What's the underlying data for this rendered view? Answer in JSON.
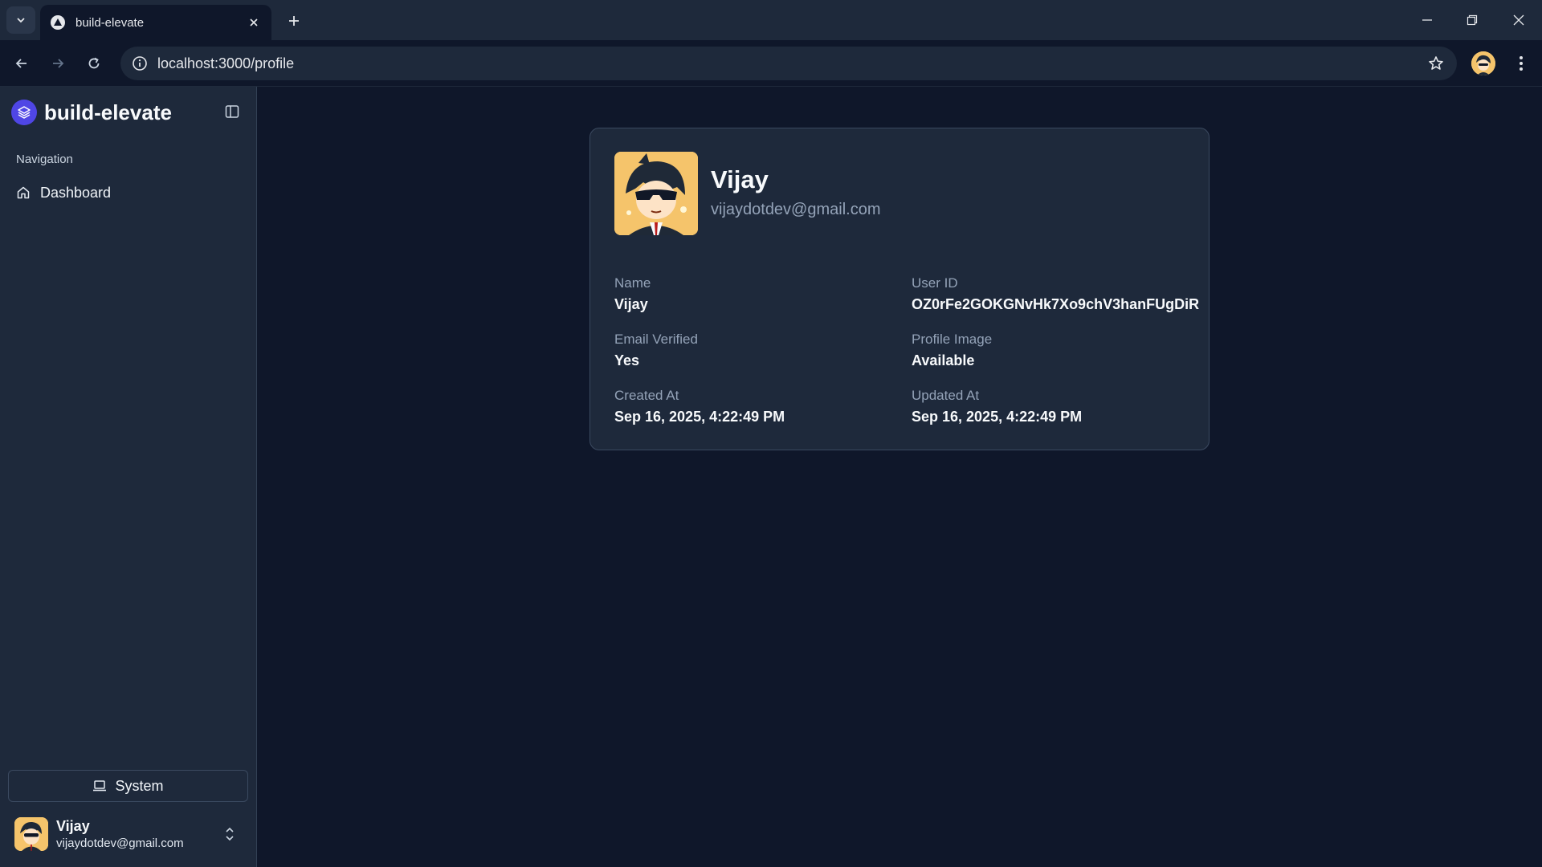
{
  "browser": {
    "tab_title": "build-elevate",
    "url": "localhost:3000/profile"
  },
  "sidebar": {
    "brand": "build-elevate",
    "nav_heading": "Navigation",
    "items": [
      {
        "label": "Dashboard",
        "icon": "home-icon"
      }
    ],
    "theme_button_label": "System",
    "user": {
      "name": "Vijay",
      "email": "vijaydotdev@gmail.com"
    }
  },
  "profile": {
    "name": "Vijay",
    "email": "vijaydotdev@gmail.com",
    "fields": [
      {
        "label": "Name",
        "value": "Vijay"
      },
      {
        "label": "User ID",
        "value": "OZ0rFe2GOKGNvHk7Xo9chV3hanFUgDiR"
      },
      {
        "label": "Email Verified",
        "value": "Yes"
      },
      {
        "label": "Profile Image",
        "value": "Available"
      },
      {
        "label": "Created At",
        "value": "Sep 16, 2025, 4:22:49 PM"
      },
      {
        "label": "Updated At",
        "value": "Sep 16, 2025, 4:22:49 PM"
      }
    ]
  },
  "colors": {
    "background": "#0f172a",
    "surface": "#1e293b",
    "brand_accent": "#4f46e5"
  }
}
